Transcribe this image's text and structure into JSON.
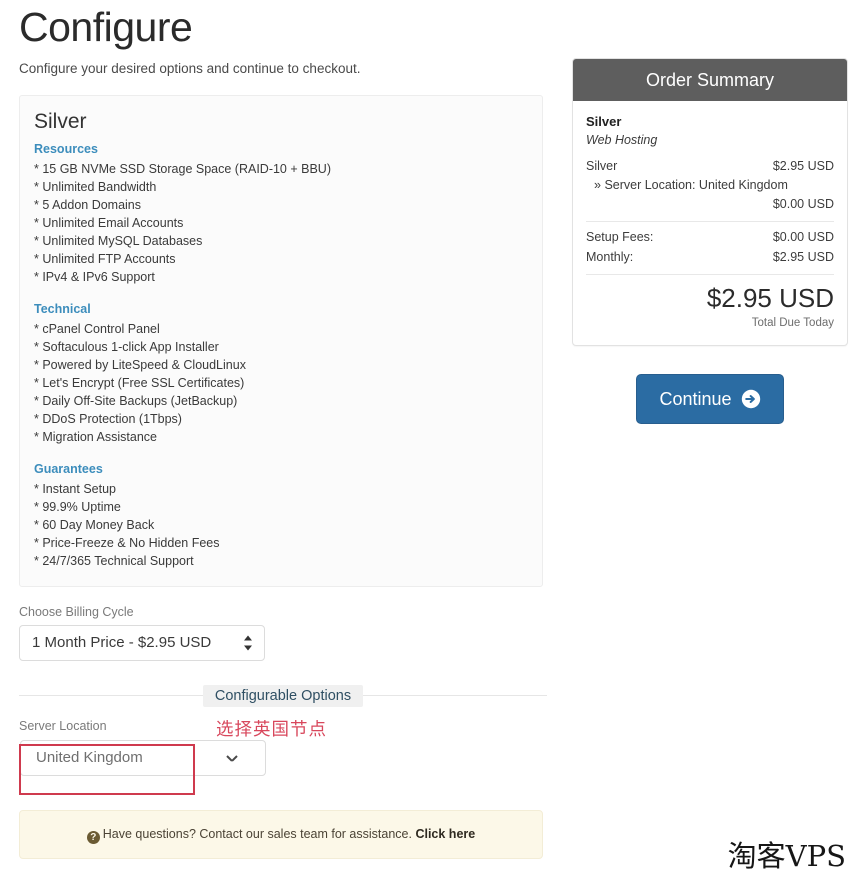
{
  "page": {
    "title": "Configure",
    "subtitle": "Configure your desired options and continue to checkout."
  },
  "product": {
    "name": "Silver",
    "feature_groups": [
      {
        "heading": "Resources",
        "items": [
          "* 15 GB NVMe SSD Storage Space (RAID-10 + BBU)",
          "* Unlimited Bandwidth",
          "* 5 Addon Domains",
          "* Unlimited Email Accounts",
          "* Unlimited MySQL Databases",
          "* Unlimited FTP Accounts",
          "* IPv4 & IPv6 Support"
        ]
      },
      {
        "heading": "Technical",
        "items": [
          "* cPanel Control Panel",
          "* Softaculous 1-click App Installer",
          "* Powered by LiteSpeed & CloudLinux",
          "* Let's Encrypt (Free SSL Certificates)",
          "* Daily Off-Site Backups (JetBackup)",
          "* DDoS Protection (1Tbps)",
          "* Migration Assistance"
        ]
      },
      {
        "heading": "Guarantees",
        "items": [
          "* Instant Setup",
          "* 99.9% Uptime",
          "* 60 Day Money Back",
          "* Price-Freeze & No Hidden Fees",
          "* 24/7/365 Technical Support"
        ]
      }
    ]
  },
  "billing": {
    "label": "Choose Billing Cycle",
    "selected": "1 Month Price - $2.95 USD",
    "stepper_icon": "updown-arrows-icon"
  },
  "configurable_options": {
    "divider_label": "Configurable Options",
    "server_location": {
      "label": "Server Location",
      "selected": "United Kingdom",
      "chevron_icon": "chevron-down-icon"
    }
  },
  "annotation": {
    "text": "选择英国节点",
    "color": "#d8475c",
    "box_color": "#cf3a4e"
  },
  "notice": {
    "icon": "help-circle-icon",
    "icon_glyph": "?",
    "text": "Have questions? Contact our sales team for assistance.",
    "link": "Click here"
  },
  "order_summary": {
    "header": "Order Summary",
    "product_name": "Silver",
    "group_name": "Web Hosting",
    "line_items": [
      {
        "label": "Silver",
        "value": "$2.95 USD"
      }
    ],
    "sub_item": {
      "prefix": "»",
      "label": "Server Location: United Kingdom",
      "value": "$0.00 USD"
    },
    "fee_rows": [
      {
        "label": "Setup Fees:",
        "value": "$0.00 USD"
      },
      {
        "label": "Monthly:",
        "value": "$2.95 USD"
      }
    ],
    "total": "$2.95 USD",
    "total_label": "Total Due Today",
    "header_bg": "#5e5e5e"
  },
  "continue": {
    "label": "Continue",
    "icon": "arrow-circle-right-icon",
    "color": "#2b6ca3"
  },
  "watermark": {
    "text": "淘客VPS"
  }
}
